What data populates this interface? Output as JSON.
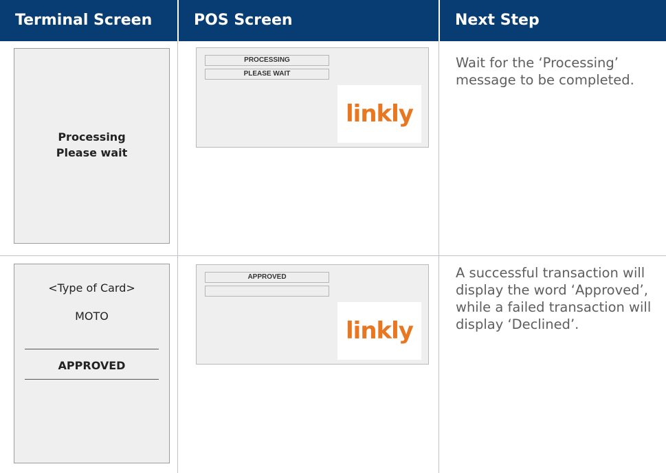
{
  "header": {
    "terminal_screen": "Terminal Screen",
    "pos_screen": "POS Screen",
    "next_step": "Next Step"
  },
  "rows": [
    {
      "terminal": {
        "line1": "Processing",
        "line2": "Please wait"
      },
      "pos": {
        "field1": "PROCESSING",
        "field2": "PLEASE WAIT",
        "logo": "linkly"
      },
      "next_step": "Wait for the ‘Processing’ message to be completed."
    },
    {
      "terminal": {
        "card_type": "<Type of Card>",
        "entry_mode": "MOTO",
        "status": "APPROVED"
      },
      "pos": {
        "field1": "APPROVED",
        "field2": "",
        "logo": "linkly"
      },
      "next_step": "A successful transaction will display the word ‘Approved’, while a failed transaction will display ‘Declined’."
    }
  ],
  "colors": {
    "header_bg": "#083d73",
    "logo": "#e87722"
  }
}
